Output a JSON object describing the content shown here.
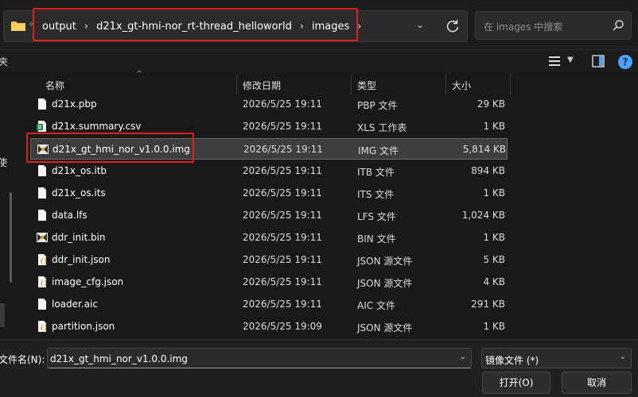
{
  "breadcrumb": {
    "items": [
      "output",
      "d21x_gt-hmi-nor_rt-thread_helloworld",
      "images"
    ],
    "overflow_chevron": "«",
    "separator": "›"
  },
  "search": {
    "placeholder": "在 images 中搜索"
  },
  "toolbar": {
    "left_fragment": "夹"
  },
  "left_pane": {
    "fragment": "使"
  },
  "columns": {
    "name": "名称",
    "date": "修改日期",
    "type": "类型",
    "size": "大小"
  },
  "files": [
    {
      "name": "d21x.pbp",
      "date": "2026/5/25 19:11",
      "type": "PBP 文件",
      "size": "29 KB",
      "icon": "file-icon"
    },
    {
      "name": "d21x.summary.csv",
      "date": "2026/5/25 19:11",
      "type": "XLS 工作表",
      "size": "1 KB",
      "icon": "spreadsheet-icon"
    },
    {
      "name": "d21x_gt_hmi_nor_v1.0.0.img",
      "date": "2026/5/25 19:11",
      "type": "IMG 文件",
      "size": "5,814 KB",
      "icon": "image-file-icon",
      "selected": true
    },
    {
      "name": "d21x_os.itb",
      "date": "2026/5/25 19:11",
      "type": "ITB 文件",
      "size": "894 KB",
      "icon": "file-icon"
    },
    {
      "name": "d21x_os.its",
      "date": "2026/5/25 19:11",
      "type": "ITS 文件",
      "size": "1 KB",
      "icon": "file-icon"
    },
    {
      "name": "data.lfs",
      "date": "2026/5/25 19:11",
      "type": "LFS 文件",
      "size": "1,024 KB",
      "icon": "file-icon"
    },
    {
      "name": "ddr_init.bin",
      "date": "2026/5/25 19:11",
      "type": "BIN 文件",
      "size": "1 KB",
      "icon": "binary-file-icon"
    },
    {
      "name": "ddr_init.json",
      "date": "2026/5/25 19:11",
      "type": "JSON 源文件",
      "size": "5 KB",
      "icon": "json-file-icon"
    },
    {
      "name": "image_cfg.json",
      "date": "2026/5/25 19:11",
      "type": "JSON 源文件",
      "size": "4 KB",
      "icon": "json-file-icon"
    },
    {
      "name": "loader.aic",
      "date": "2026/5/25 19:11",
      "type": "AIC 文件",
      "size": "291 KB",
      "icon": "file-icon"
    },
    {
      "name": "partition.json",
      "date": "2026/5/25 19:09",
      "type": "JSON 源文件",
      "size": "1 KB",
      "icon": "json-file-icon"
    }
  ],
  "filename": {
    "label": "文件名(N):",
    "value": "d21x_gt_hmi_nor_v1.0.0.img"
  },
  "filetype": {
    "value": "镜像文件 (*)"
  },
  "buttons": {
    "open": "打开(O)",
    "cancel": "取消"
  },
  "help": {
    "glyph": "?"
  },
  "colors": {
    "background": "#1c1c1c",
    "highlight_box": "#e02020",
    "selected_row": "#3d3d3d",
    "accent": "#4aa3ff"
  }
}
